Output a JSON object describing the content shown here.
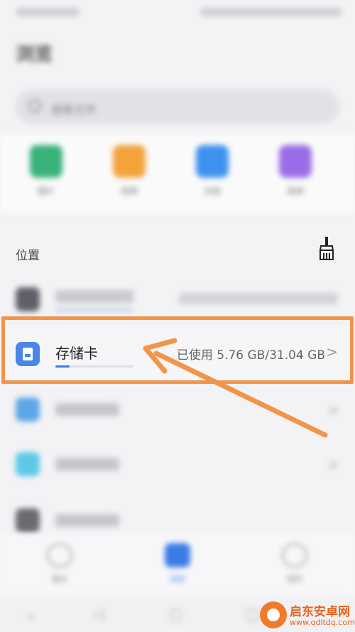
{
  "header": {
    "title": "浏览"
  },
  "search": {
    "placeholder": "搜索文件"
  },
  "categories": [
    {
      "label": "图片",
      "color": "#39b27a"
    },
    {
      "label": "视频",
      "color": "#f3a33a"
    },
    {
      "label": "文档",
      "color": "#3f91ef"
    },
    {
      "label": "音频",
      "color": "#9a6de8"
    }
  ],
  "locations": {
    "title": "位置",
    "storage_card": {
      "name": "存储卡",
      "usage": "已使用 5.76 GB/31.04 GB",
      "used_fraction": 0.186
    }
  },
  "bottom_nav": [
    {
      "label": "最近"
    },
    {
      "label": "浏览"
    },
    {
      "label": "我的"
    }
  ],
  "colors": {
    "accent": "#3b7ce8",
    "highlight": "#f0954a"
  },
  "watermark": {
    "brand": "启东安卓网",
    "url": "www.qdltdq.com"
  }
}
